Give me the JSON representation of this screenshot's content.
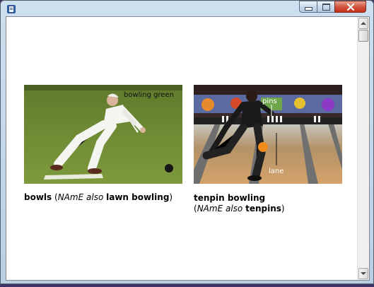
{
  "window": {
    "title_icon": "app-icon",
    "controls": {
      "minimize": "minimize-icon",
      "maximize": "maximize-icon",
      "close": "close-icon"
    }
  },
  "bowls": {
    "image_label": "bowling green",
    "caption": {
      "term": "bowls",
      "open": "(",
      "region": "NAmE",
      "also": "also",
      "alt_term": "lawn bowling",
      "close": ")"
    }
  },
  "tenpin": {
    "labels": {
      "pins": "pins",
      "lane": "lane"
    },
    "caption": {
      "term": "tenpin bowling",
      "open": "(",
      "region": "NAmE",
      "also": "also",
      "alt_term": "tenpins",
      "close": ")"
    }
  },
  "colors": {
    "title_bar": "#c4d8ec",
    "close_button": "#c7301b",
    "page_bg": "#ffffff"
  }
}
